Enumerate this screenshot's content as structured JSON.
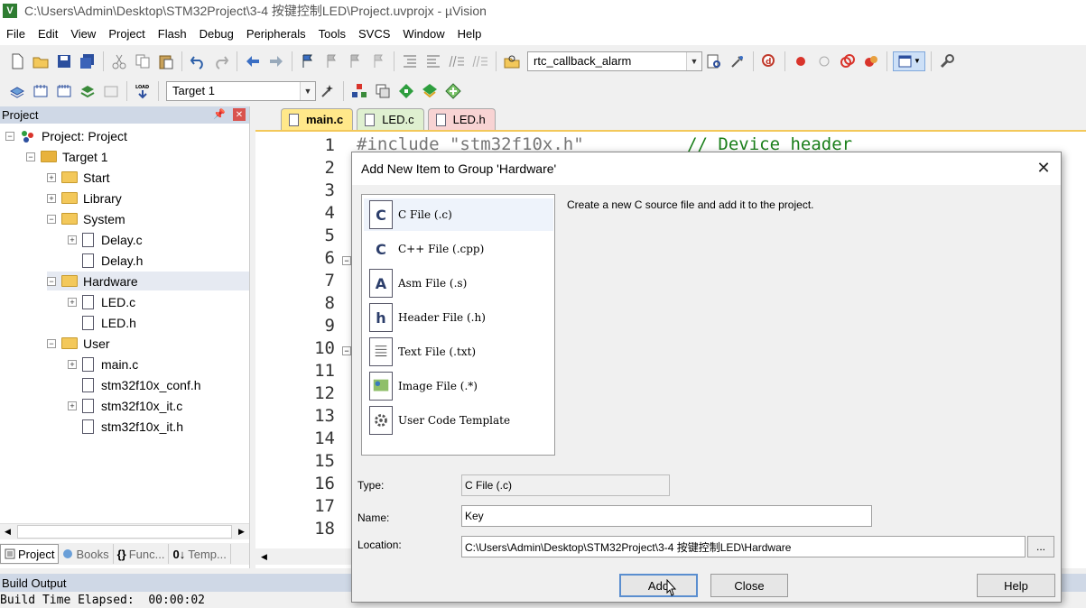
{
  "window": {
    "title": "C:\\Users\\Admin\\Desktop\\STM32Project\\3-4 按键控制LED\\Project.uvprojx - µVision",
    "app_icon": "V"
  },
  "menu": [
    "File",
    "Edit",
    "View",
    "Project",
    "Flash",
    "Debug",
    "Peripherals",
    "Tools",
    "SVCS",
    "Window",
    "Help"
  ],
  "toolbar": {
    "find_combo": "rtc_callback_alarm",
    "target_combo": "Target 1",
    "load_label": "LOAD"
  },
  "project_panel": {
    "title": "Project",
    "tree": [
      {
        "label": "Project: Project"
      },
      {
        "label": "Target 1"
      },
      {
        "label": "Start"
      },
      {
        "label": "Library"
      },
      {
        "label": "System"
      },
      {
        "label": "Delay.c"
      },
      {
        "label": "Delay.h"
      },
      {
        "label": "Hardware"
      },
      {
        "label": "LED.c"
      },
      {
        "label": "LED.h"
      },
      {
        "label": "User"
      },
      {
        "label": "main.c"
      },
      {
        "label": "stm32f10x_conf.h"
      },
      {
        "label": "stm32f10x_it.c"
      },
      {
        "label": "stm32f10x_it.h"
      }
    ],
    "tabs": [
      "Project",
      "Books",
      "Func...",
      "Temp..."
    ]
  },
  "editor": {
    "tabs": [
      "main.c",
      "LED.c",
      "LED.h"
    ],
    "line_numbers": [
      "1",
      "2",
      "3",
      "4",
      "5",
      "6",
      "7",
      "8",
      "9",
      "10",
      "11",
      "12",
      "13",
      "14",
      "15",
      "16",
      "17",
      "18"
    ],
    "code_first_line": "#include \"stm32f10x.h\"",
    "code_first_comment": "// Device header"
  },
  "build_output": {
    "title": "Build Output",
    "text": "Build Time Elapsed:  00:00:02"
  },
  "dialog": {
    "title": "Add New Item to Group 'Hardware'",
    "close_glyph": "✕",
    "items": [
      {
        "label": "C File (.c)",
        "icon_glyph": "C"
      },
      {
        "label": "C++ File (.cpp)",
        "icon_glyph": "C"
      },
      {
        "label": "Asm File (.s)",
        "icon_glyph": "A"
      },
      {
        "label": "Header File (.h)",
        "icon_glyph": "h"
      },
      {
        "label": "Text File (.txt)",
        "icon_glyph": ""
      },
      {
        "label": "Image File (.*)",
        "icon_glyph": ""
      },
      {
        "label": "User Code Template",
        "icon_glyph": ""
      }
    ],
    "description": "Create a new C source file and add it to the project.",
    "type_label": "Type:",
    "type_value": "C File (.c)",
    "name_label": "Name:",
    "name_value": "Key",
    "location_label": "Location:",
    "location_value": "C:\\Users\\Admin\\Desktop\\STM32Project\\3-4 按键控制LED\\Hardware",
    "browse_label": "...",
    "add_label": "Add",
    "close_label": "Close",
    "help_label": "Help"
  }
}
